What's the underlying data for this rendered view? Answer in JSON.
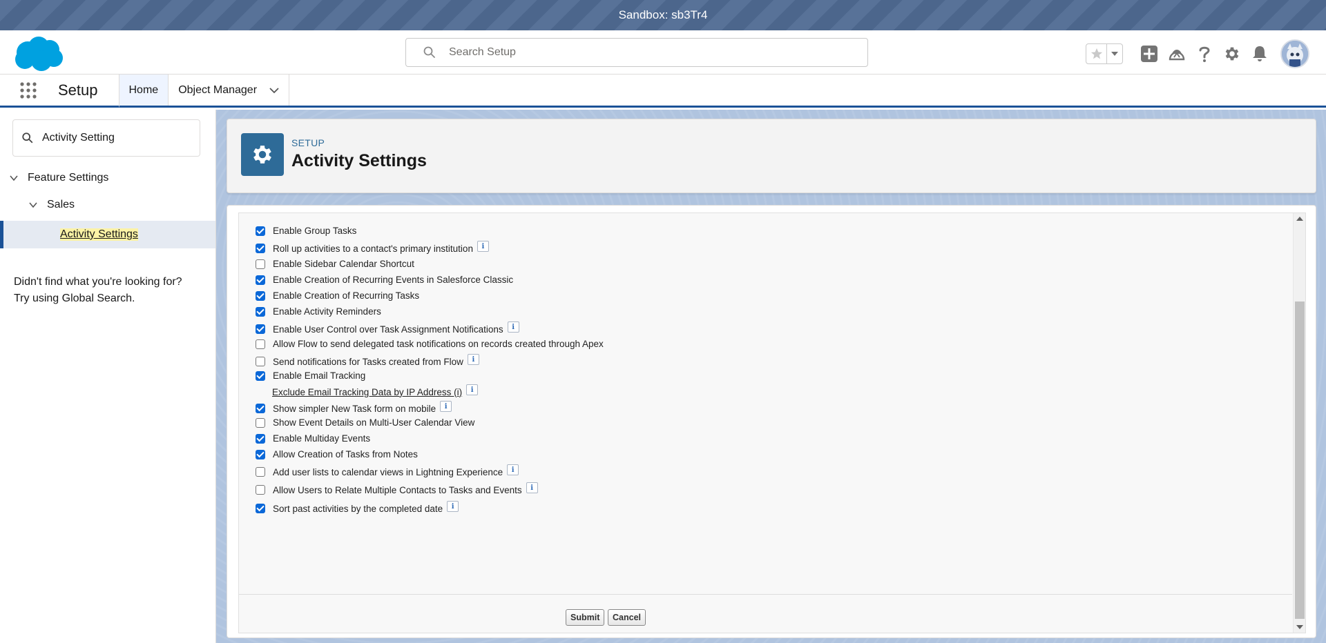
{
  "banner": {
    "text": "Sandbox: sb3Tr4"
  },
  "header": {
    "search_placeholder": "Search Setup",
    "icons": [
      "favorites-star-icon",
      "favorites-dropdown-icon",
      "global-actions-plus-icon",
      "trailhead-icon",
      "help-icon",
      "setup-gear-icon",
      "notifications-bell-icon",
      "user-avatar"
    ]
  },
  "nav": {
    "app_name": "Setup",
    "tabs": [
      {
        "label": "Home",
        "active": true
      },
      {
        "label": "Object Manager",
        "active": false
      }
    ]
  },
  "sidebar": {
    "quickfind_value": "Activity Setting",
    "tree": {
      "level1": "Feature Settings",
      "level2": "Sales",
      "selected": "Activity Settings"
    },
    "help_line1": "Didn't find what you're looking for?",
    "help_line2": "Try using Global Search."
  },
  "page_header": {
    "kicker": "SETUP",
    "title": "Activity Settings"
  },
  "settings": [
    {
      "label": "Enable Group Tasks",
      "checked": true,
      "info": false
    },
    {
      "label": "Roll up activities to a contact's primary institution",
      "checked": true,
      "info": true
    },
    {
      "label": "Enable Sidebar Calendar Shortcut",
      "checked": false,
      "info": false
    },
    {
      "label": "Enable Creation of Recurring Events in Salesforce Classic",
      "checked": true,
      "info": false
    },
    {
      "label": "Enable Creation of Recurring Tasks",
      "checked": true,
      "info": false
    },
    {
      "label": "Enable Activity Reminders",
      "checked": true,
      "info": false
    },
    {
      "label": "Enable User Control over Task Assignment Notifications",
      "checked": true,
      "info": true
    },
    {
      "label": "Allow Flow to send delegated task notifications on records created through Apex",
      "checked": false,
      "info": false
    },
    {
      "label": "Send notifications for Tasks created from Flow",
      "checked": false,
      "info": true
    },
    {
      "label": "Enable Email Tracking",
      "checked": true,
      "info": false
    },
    {
      "label": "Exclude Email Tracking Data by IP Address (i)",
      "link": true,
      "info": true
    },
    {
      "label": "Show simpler New Task form on mobile",
      "checked": true,
      "info": true
    },
    {
      "label": "Show Event Details on Multi-User Calendar View",
      "checked": false,
      "info": false
    },
    {
      "label": "Enable Multiday Events",
      "checked": true,
      "info": false
    },
    {
      "label": "Allow Creation of Tasks from Notes",
      "checked": true,
      "info": false
    },
    {
      "label": "Add user lists to calendar views in Lightning Experience",
      "checked": false,
      "info": true
    },
    {
      "label": "Allow Users to Relate Multiple Contacts to Tasks and Events",
      "checked": false,
      "info": true
    },
    {
      "label": "Sort past activities by the completed date",
      "checked": true,
      "info": true
    }
  ],
  "buttons": {
    "submit": "Submit",
    "cancel": "Cancel"
  },
  "info_glyph": "i",
  "colors": {
    "brand_blue": "#1b5297",
    "checkbox_blue": "#0b68d8",
    "setup_icon_bg": "#2e6b98",
    "highlight": "#fcf3a6"
  }
}
